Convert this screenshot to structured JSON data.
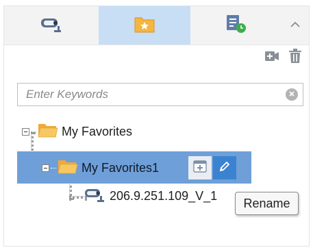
{
  "tabs": [
    {
      "id": "camera",
      "icon": "camera-icon",
      "active": false
    },
    {
      "id": "favorites",
      "icon": "favorites-folder-icon",
      "active": true
    },
    {
      "id": "record",
      "icon": "record-schedule-icon",
      "active": false
    }
  ],
  "toolbar": {
    "add_icon": "add-camera-icon",
    "delete_icon": "trash-icon"
  },
  "search": {
    "placeholder": "Enter Keywords",
    "value": ""
  },
  "tree": {
    "root": {
      "label": "My Favorites"
    },
    "child": {
      "label": "My Favorites1",
      "selected": true
    },
    "camera": {
      "label": "206.9.251.109_V_1"
    }
  },
  "tooltip": {
    "text": "Rename"
  },
  "colors": {
    "tab_bar": "#f3f3f3",
    "active_tab": "#c8def4",
    "selected_row": "#6f9fd8",
    "folder": "#f4b63f",
    "accent_button": "#3b82d0"
  }
}
